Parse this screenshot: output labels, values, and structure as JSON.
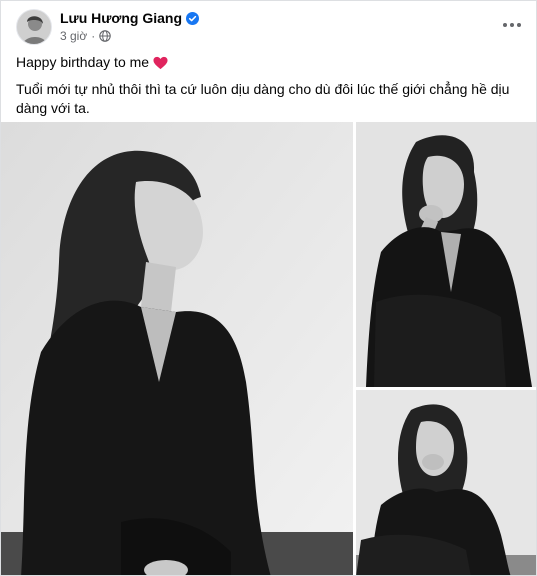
{
  "post": {
    "author": {
      "name": "Lưu Hương Giang",
      "verified_icon": "verified-check-icon",
      "avatar": "avatar-photo"
    },
    "meta": {
      "time": "3 giờ",
      "separator": "·",
      "audience_icon": "globe-icon"
    },
    "more_icon": "more-horizontal-icon",
    "text": {
      "line1": "Happy birthday to me",
      "line1_emoji": "red-heart-icon",
      "line2": "Tuổi mới tự nhủ thôi thì ta cứ luôn dịu dàng cho dù đôi lúc thế giới chẳng hề dịu dàng với ta."
    },
    "photos": [
      {
        "name": "photo-main",
        "kind": "black-and-white portrait"
      },
      {
        "name": "photo-top-right",
        "kind": "black-and-white portrait"
      },
      {
        "name": "photo-bottom-right",
        "kind": "black-and-white portrait"
      }
    ],
    "colors": {
      "verified": "#1877f2",
      "heart": "#e0245e",
      "secondary_text": "#65676b",
      "primary_text": "#050505"
    }
  }
}
